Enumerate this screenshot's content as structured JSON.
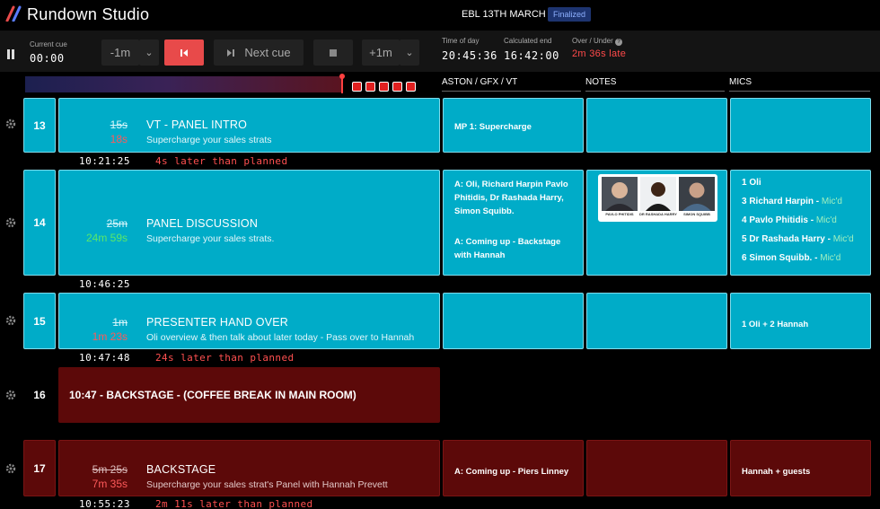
{
  "header": {
    "app_title": "Rundown Studio",
    "show_title": "EBL 13TH MARCH",
    "status_badge": "Finalized"
  },
  "controls": {
    "current_cue_label": "Current cue",
    "current_cue_time": "00:00",
    "minus_label": "-1m",
    "next_cue_label": "Next cue",
    "plus_label": "+1m",
    "time_of_day_label": "Time of day",
    "time_of_day": "20:45:36",
    "calc_end_label": "Calculated end",
    "calc_end": "16:42:00",
    "over_under_label": "Over / Under",
    "over_under_value": "2m 36s late"
  },
  "columns": {
    "aston": "ASTON / GFX / VT",
    "notes": "NOTES",
    "mics": "MICS"
  },
  "colors": {
    "teal": "#00acc8",
    "maroon": "#5c0909",
    "late_red": "#ff4a4a",
    "accent_red": "#e84a4a",
    "early_green": "#5ae86a"
  },
  "cues": [
    {
      "number": "13",
      "planned": "15s",
      "actual": "18s",
      "title": "VT - PANEL INTRO",
      "subtitle": "Supercharge your sales strats",
      "aston": "MP 1: Supercharge",
      "start_time": "10:21:25",
      "offset": "4s later than planned"
    },
    {
      "number": "14",
      "planned": "25m",
      "actual": "24m 59s",
      "title": "PANEL DISCUSSION",
      "subtitle": "Supercharge your sales strats.",
      "aston_1": "A: Oli, Richard Harpin Pavlo Phitidis, Dr Rashada Harry, Simon Squibb.",
      "aston_2": "A: Coming up - Backstage with Hannah",
      "photo_captions": [
        "PAVLO PHITIDIS",
        "DR RASHADA HARRY",
        "SIMON SQUIBB"
      ],
      "mics": [
        {
          "name": "1 Oli",
          "status": ""
        },
        {
          "name": "3 Richard Harpin - ",
          "status": "Mic'd"
        },
        {
          "name": "4 Pavlo Phitidis - ",
          "status": "Mic'd"
        },
        {
          "name": "5 Dr Rashada Harry - ",
          "status": "Mic'd"
        },
        {
          "name": "6 Simon Squibb. - ",
          "status": "Mic'd"
        }
      ],
      "start_time": "10:46:25"
    },
    {
      "number": "15",
      "planned": "1m",
      "actual": "1m 23s",
      "title": "PRESENTER HAND OVER",
      "subtitle": "Oli overview & then talk about later today - Pass over to Hannah",
      "mics": "1 Oli + 2 Hannah",
      "start_time": "10:47:48",
      "offset": "24s later than planned"
    },
    {
      "number": "16",
      "heading": "10:47 - BACKSTAGE - (COFFEE BREAK IN MAIN ROOM)"
    },
    {
      "number": "17",
      "planned": "5m 25s",
      "actual": "7m 35s",
      "title": "BACKSTAGE",
      "subtitle": "Supercharge your sales strat's Panel with Hannah Prevett",
      "aston": "A: Coming up - Piers Linney",
      "mics": "Hannah + guests",
      "start_time": "10:55:23",
      "offset": "2m 11s later than planned"
    }
  ]
}
